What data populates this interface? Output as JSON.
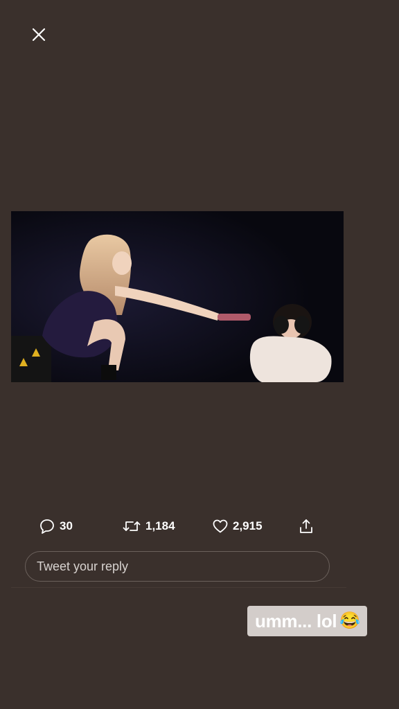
{
  "viewer": {
    "close_icon": "close-icon"
  },
  "tweet": {
    "reply_count": "30",
    "retweet_count": "1,184",
    "like_count": "2,915",
    "icons": {
      "reply": "speech-bubble-icon",
      "retweet": "retweet-icon",
      "like": "heart-icon",
      "share": "share-icon"
    }
  },
  "reply": {
    "placeholder": "Tweet your reply"
  },
  "story_caption": {
    "text": "umm... lol",
    "emoji": "😂"
  },
  "colors": {
    "background": "#3a302c",
    "caption_bg": "#d3cdca",
    "text": "#ffffff"
  }
}
